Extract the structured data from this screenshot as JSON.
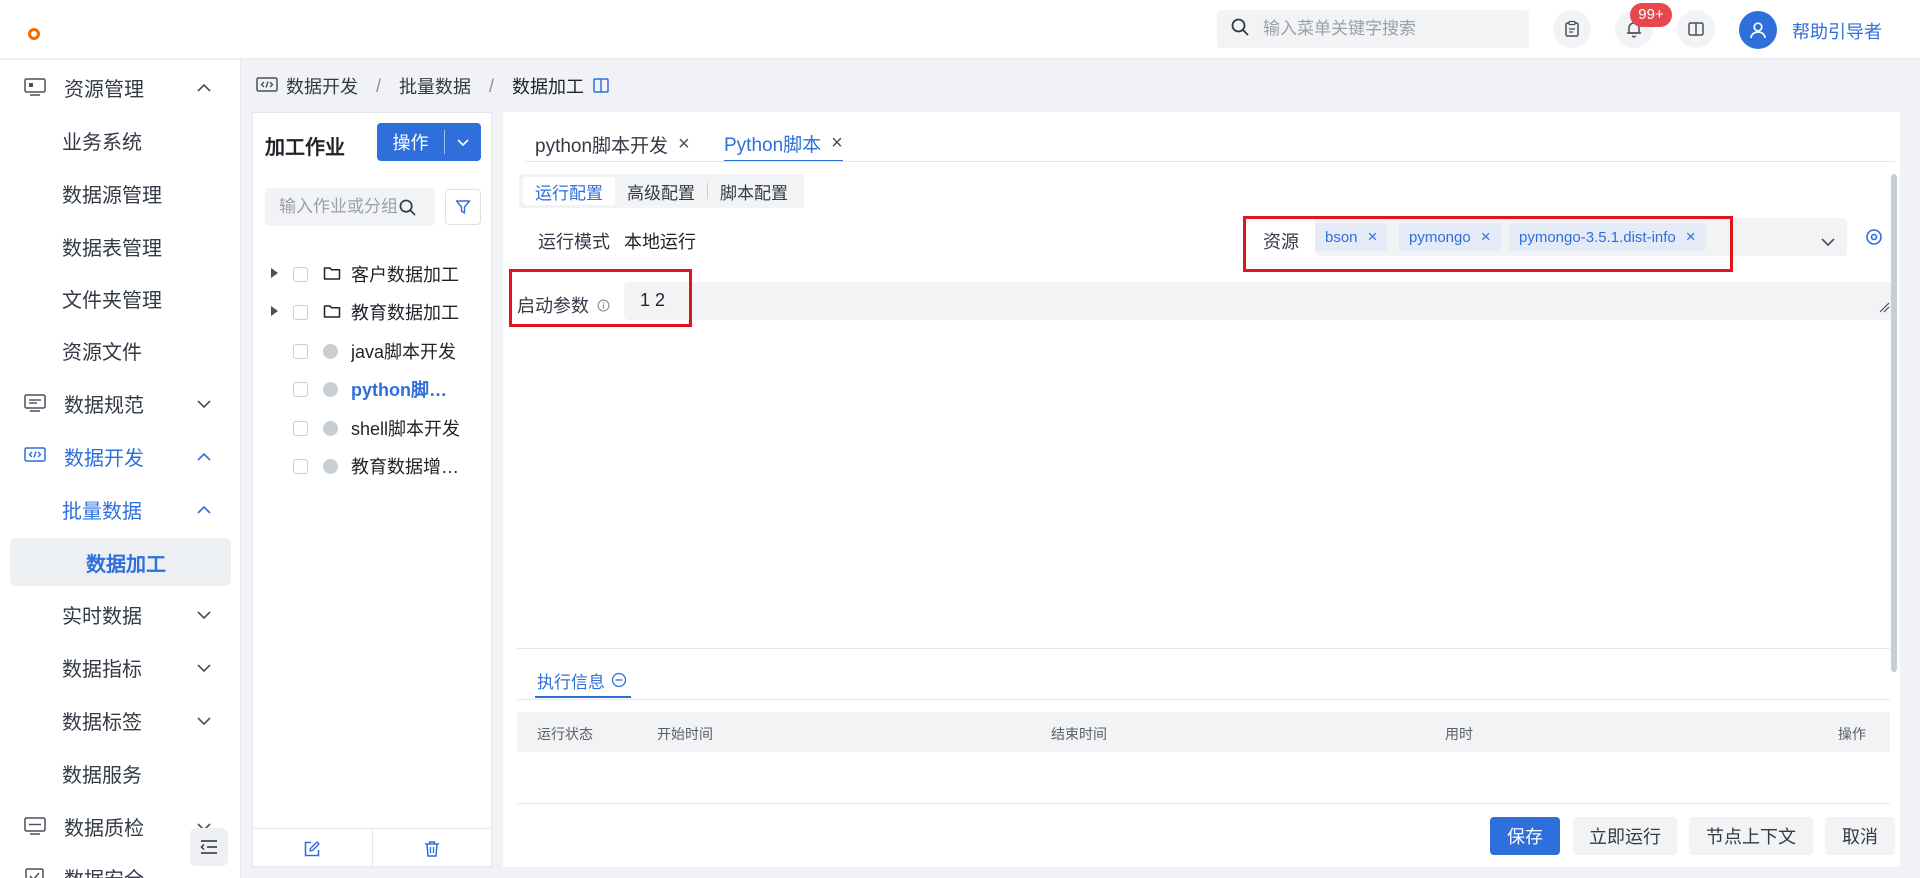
{
  "header": {
    "search_placeholder": "输入菜单关键字搜索",
    "notification_badge": "99+",
    "user_name": "帮助引导者"
  },
  "sidebar": {
    "items": [
      {
        "label": "资源管理"
      },
      {
        "label": "业务系统"
      },
      {
        "label": "数据源管理"
      },
      {
        "label": "数据表管理"
      },
      {
        "label": "文件夹管理"
      },
      {
        "label": "资源文件"
      },
      {
        "label": "数据规范"
      },
      {
        "label": "数据开发"
      },
      {
        "label": "批量数据"
      },
      {
        "label": "数据加工"
      },
      {
        "label": "实时数据"
      },
      {
        "label": "数据指标"
      },
      {
        "label": "数据标签"
      },
      {
        "label": "数据服务"
      },
      {
        "label": "数据质检"
      },
      {
        "label": "数据安全"
      }
    ]
  },
  "breadcrumb": {
    "items": [
      "数据开发",
      "批量数据",
      "数据加工"
    ],
    "separator": "/"
  },
  "jobs_panel": {
    "title": "加工作业",
    "ops_button": "操作",
    "search_placeholder": "输入作业或分组",
    "tree": [
      {
        "name": "客户数据加工",
        "type": "folder"
      },
      {
        "name": "教育数据加工",
        "type": "folder"
      },
      {
        "name": "java脚本开发",
        "type": "job"
      },
      {
        "name": "python脚本开发",
        "type": "job",
        "selected": true
      },
      {
        "name": "shell脚本开发",
        "type": "job"
      },
      {
        "name": "教育数据增量同步",
        "type": "job"
      }
    ]
  },
  "main": {
    "tabs": [
      {
        "label": "python脚本开发",
        "active": false
      },
      {
        "label": "Python脚本",
        "active": true
      }
    ],
    "subtabs": [
      {
        "label": "运行配置",
        "active": true
      },
      {
        "label": "高级配置",
        "active": false
      },
      {
        "label": "脚本配置",
        "active": false
      }
    ],
    "run_mode_label": "运行模式",
    "run_mode_value": "本地运行",
    "resource_label": "资源",
    "resource_tags": [
      "bson",
      "pymongo",
      "pymongo-3.5.1.dist-info"
    ],
    "start_params_label": "启动参数",
    "start_params_value": "1 2",
    "exec_info_tab": "执行信息",
    "table_headers": [
      "运行状态",
      "开始时间",
      "结束时间",
      "用时",
      "操作"
    ],
    "buttons": {
      "save": "保存",
      "run_now": "立即运行",
      "node_context": "节点上下文",
      "cancel": "取消"
    }
  },
  "colors": {
    "accent": "#2f6fdb",
    "highlight_box": "#e0161c",
    "badge": "#e5484d"
  }
}
